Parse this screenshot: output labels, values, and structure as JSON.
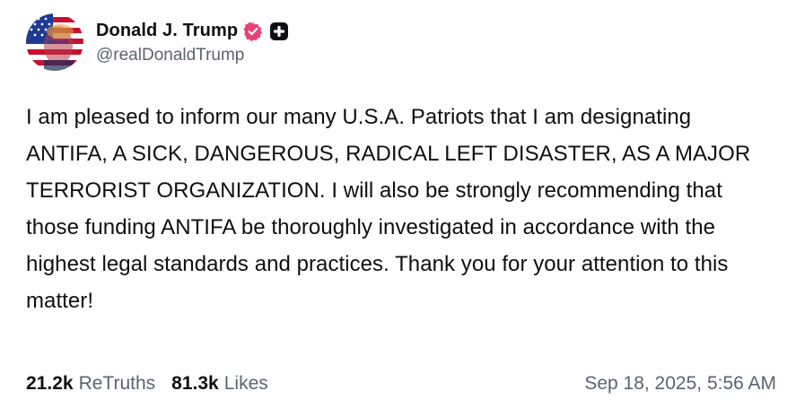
{
  "author": {
    "display_name": "Donald J. Trump",
    "handle": "@realDonaldTrump",
    "avatar_icon": "flag-portrait-avatar",
    "verified_icon": "verified-badge-icon",
    "verified_color": "#e8407a",
    "plus_icon": "plus-badge-icon"
  },
  "post": {
    "text": "I am pleased to inform our many U.S.A. Patriots that I am designating ANTIFA, A SICK, DANGEROUS, RADICAL LEFT DISASTER, AS A MAJOR TERRORIST ORGANIZATION. I will also be strongly recommending that those funding ANTIFA be thoroughly investigated in accordance with the highest legal standards and practices. Thank you for your attention to this matter!"
  },
  "stats": {
    "retruths_count": "21.2k",
    "retruths_label": "ReTruths",
    "likes_count": "81.3k",
    "likes_label": "Likes"
  },
  "timestamp": "Sep 18, 2025, 5:56 AM",
  "colors": {
    "text": "#0f0f14",
    "muted": "#5c6370",
    "background": "#ffffff"
  }
}
